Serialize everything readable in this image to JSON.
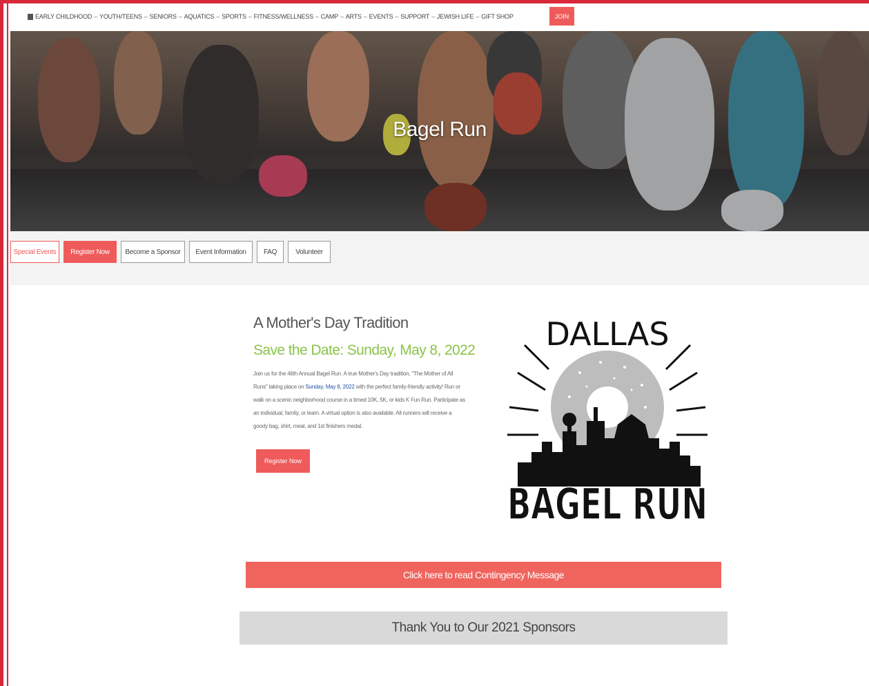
{
  "topnav": {
    "items": [
      "EARLY CHILDHOOD",
      "YOUTH/TEENS",
      "SENIORS",
      "AQUATICS",
      "SPORTS",
      "FITNESS/WELLNESS",
      "CAMP",
      "ARTS",
      "EVENTS",
      "SUPPORT",
      "JEWISH LIFE",
      "GIFT SHOP"
    ],
    "separator": "–",
    "join_label": "JOIN"
  },
  "hero": {
    "title": "Bagel Run"
  },
  "subnav": {
    "tabs": [
      "Special Events",
      "Register Now",
      "Become a Sponsor",
      "Event Information",
      "FAQ",
      "Volunteer"
    ]
  },
  "main": {
    "heading": "A Mother's Day Tradition",
    "date_line": "Save the Date: Sunday, May 8, 2022",
    "body_before": "Join us for the 46th Annual Bagel Run. A true Mother's Day tradition, \"The Mother of All Runs\" taking place on ",
    "body_highlight": "Sunday, May 8, 2022",
    "body_after": " with the perfect family-friendly activity! Run or walk on a scenic neighborhood course in a timed 10K, 5K, or kids K Fun Run. Participate as an individual, family, or team. A virtual option is also available. All runners will receive a goody bag, shirt, meal, and 1st finishers medal.",
    "register_label": "Register Now",
    "logo": {
      "top_text": "DALLAS",
      "bottom_text": "BAGEL RUN"
    },
    "contingency_label": "Click here to read Contingency Message",
    "sponsors_label": "Thank You to Our 2021 Sponsors"
  },
  "colors": {
    "accent": "#ef5b5b",
    "date_green": "#8bc34a",
    "frame_red": "#d8283a"
  }
}
